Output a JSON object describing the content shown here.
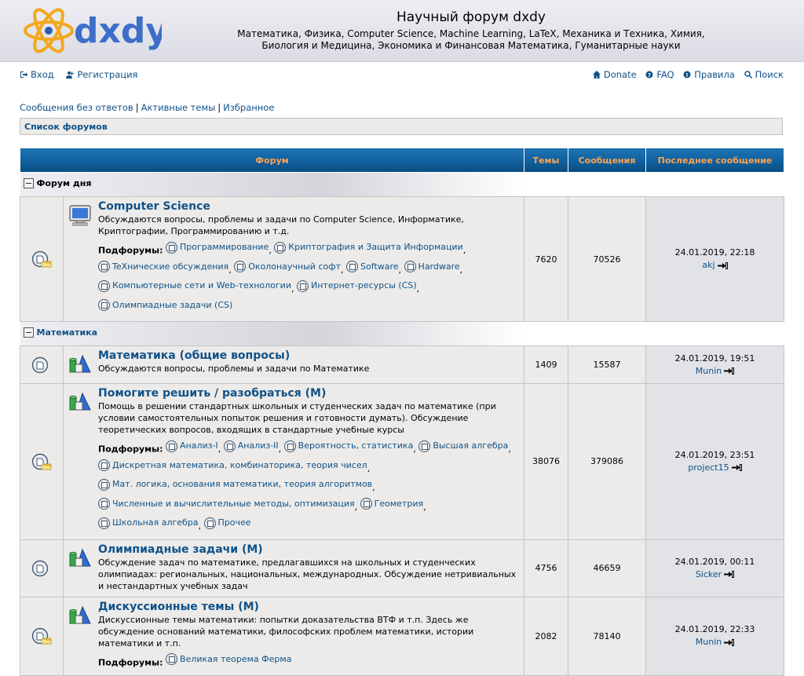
{
  "site": {
    "logo_text": "dxdy",
    "title": "Научный форум dxdy",
    "subtitle_line1": "Математика, Физика, Computer Science, Machine Learning, LaTeX, Механика и Техника, Химия,",
    "subtitle_line2": "Биология и Медицина, Экономика и Финансовая Математика, Гуманитарные науки"
  },
  "nav": {
    "login": "Вход",
    "register": "Регистрация",
    "donate": "Donate",
    "faq": "FAQ",
    "rules": "Правила",
    "search": "Поиск"
  },
  "quicklinks": {
    "unanswered": "Сообщения без ответов",
    "active": "Активные темы",
    "favorites": "Избранное"
  },
  "breadcrumb": "Список форумов",
  "table_headers": {
    "forum": "Форум",
    "topics": "Темы",
    "posts": "Сообщения",
    "last_post": "Последнее сообщение"
  },
  "subforums_label": "Подфорумы:",
  "categories": [
    {
      "title": "Форум дня",
      "forums": [
        {
          "title": "Computer Science",
          "desc": "Обсуждаются вопросы, проблемы и задачи по Computer Science, Информатике, Криптографии, Программированию и т.д.",
          "subforums": [
            "Программирование",
            "Криптография и Защита Информации",
            "TeXнические обсуждения",
            "Околонаучный софт",
            "Software",
            "Hardware",
            "Компьютерные сети и Web-технологии",
            "Интернет-ресурсы (CS)",
            "Олимпиадные задачи (CS)"
          ],
          "topics": "7620",
          "posts": "70526",
          "last_date": "24.01.2019, 22:18",
          "last_user": "akj",
          "icon": "computer-icon"
        }
      ]
    },
    {
      "title": "Математика",
      "forums": [
        {
          "title": "Математика (общие вопросы)",
          "desc": "Обсуждаются вопросы, проблемы и задачи по Математике",
          "subforums": [],
          "topics": "1409",
          "posts": "15587",
          "last_date": "24.01.2019, 19:51",
          "last_user": "Munin",
          "icon": "math-shapes-icon"
        },
        {
          "title": "Помогите решить / разобраться (М)",
          "desc": "Помощь в решении стандартных школьных и студенческих задач по математике (при условии самостоятельных попыток решения и готовности думать). Обсуждение теоретических вопросов, входящих в стандартные учебные курсы",
          "subforums": [
            "Анализ-I",
            "Анализ-II",
            "Вероятность, статистика",
            "Высшая алгебра",
            "Дискретная математика, комбинаторика, теория чисел",
            "Мат. логика, основания математики, теория алгоритмов",
            "Численные и вычислительные методы, оптимизация",
            "Геометрия",
            "Школьная алгебра",
            "Прочее"
          ],
          "topics": "38076",
          "posts": "379086",
          "last_date": "24.01.2019, 23:51",
          "last_user": "project15",
          "icon": "math-shapes-icon"
        },
        {
          "title": "Олимпиадные задачи (М)",
          "desc": "Обсуждение задач по математике, предлагавшихся на школьных и студенческих олимпиадах: региональных, национальных, международных. Обсуждение нетривиальных и нестандартных учебных задач",
          "subforums": [],
          "topics": "4756",
          "posts": "46659",
          "last_date": "24.01.2019, 00:11",
          "last_user": "Sicker",
          "icon": "math-shapes-icon"
        },
        {
          "title": "Дискуссионные темы (М)",
          "desc": "Дискуссионные темы математики: попытки доказательства ВТФ и т.п. Здесь же обсуждение оснований математики, философских проблем математики, истории математики и т.п.",
          "subforums": [
            "Великая теорема Ферма"
          ],
          "topics": "2082",
          "posts": "78140",
          "last_date": "24.01.2019, 22:33",
          "last_user": "Munin",
          "icon": "math-shapes-icon"
        }
      ]
    }
  ]
}
